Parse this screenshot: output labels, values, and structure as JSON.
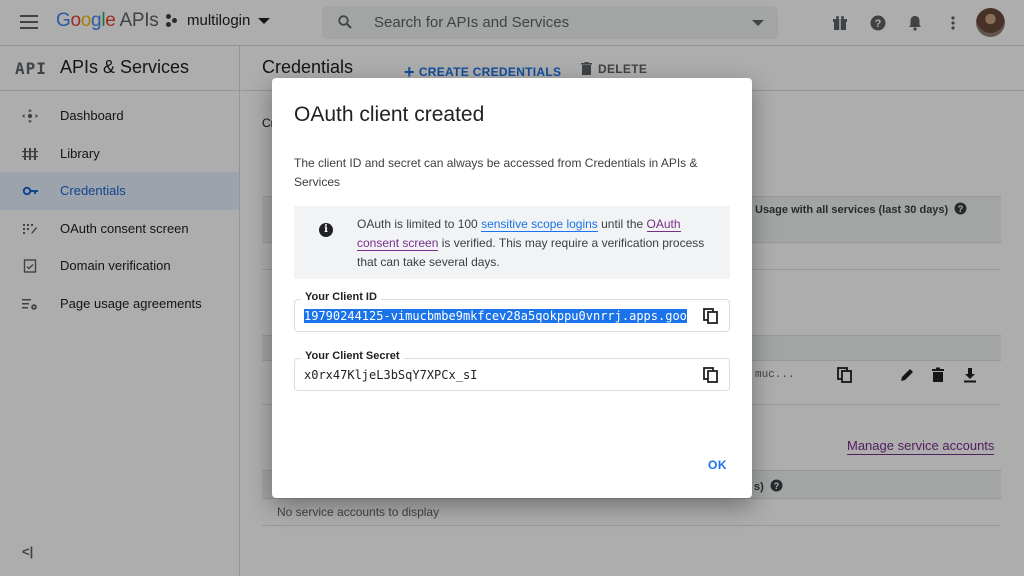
{
  "topbar": {
    "logo_text": "Google",
    "logo_apis": "APIs",
    "project_name": "multilogin",
    "search_placeholder": "Search for APIs and Services"
  },
  "sidebar": {
    "api_badge": "API",
    "title": "APIs & Services",
    "items": [
      {
        "label": "Dashboard",
        "icon": "dashboard-icon"
      },
      {
        "label": "Library",
        "icon": "library-icon"
      },
      {
        "label": "Credentials",
        "icon": "key-icon",
        "active": true
      },
      {
        "label": "OAuth consent screen",
        "icon": "consent-icon"
      },
      {
        "label": "Domain verification",
        "icon": "domain-icon"
      },
      {
        "label": "Page usage agreements",
        "icon": "agreements-icon"
      }
    ],
    "collapse_label": "<|"
  },
  "main": {
    "title": "Credentials",
    "create_label": "CREATE CREDENTIALS",
    "delete_label": "DELETE",
    "partial_text": "Cr",
    "usage_header": "Usage with all services (last 30 days)",
    "truncated_value": "muc...",
    "manage_link": "Manage service accounts",
    "partial_header_suffix": "s)",
    "empty_service_accounts": "No service accounts to display"
  },
  "dialog": {
    "title": "OAuth client created",
    "description": "The client ID and secret can always be accessed from Credentials in APIs & Services",
    "info_pre": "OAuth is limited to 100 ",
    "info_link1": "sensitive scope logins",
    "info_mid": " until the ",
    "info_link2": "OAuth consent screen",
    "info_post": " is verified. This may require a verification process that can take several days.",
    "client_id_label": "Your Client ID",
    "client_id_value": "19790244125-vimucbmbe9mkfcev28a5qokppu0vnrrj.apps.goo",
    "client_secret_label": "Your Client Secret",
    "client_secret_value": "x0rx47KljeL3bSqY7XPCx_sI",
    "ok_label": "OK"
  },
  "colors": {
    "accent": "#1a73e8",
    "active_bg": "#e8f0fe",
    "link_visited": "#7b2d8c"
  }
}
